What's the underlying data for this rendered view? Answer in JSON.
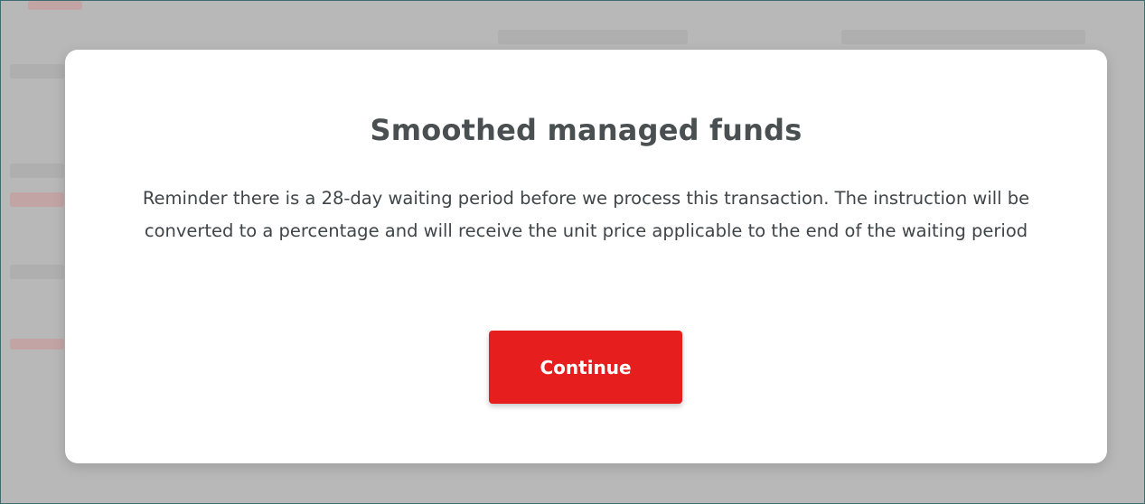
{
  "modal": {
    "title": "Smoothed managed funds",
    "message": "Reminder there is a 28-day waiting period before we process this transaction. The instruction will be converted to a percentage and will receive the unit price applicable to the end of the waiting period",
    "continue_label": "Continue"
  },
  "colors": {
    "accent": "#e61e1e",
    "overlay": "#bdbdbd",
    "modal_background": "#ffffff",
    "text": "#4a5052"
  }
}
